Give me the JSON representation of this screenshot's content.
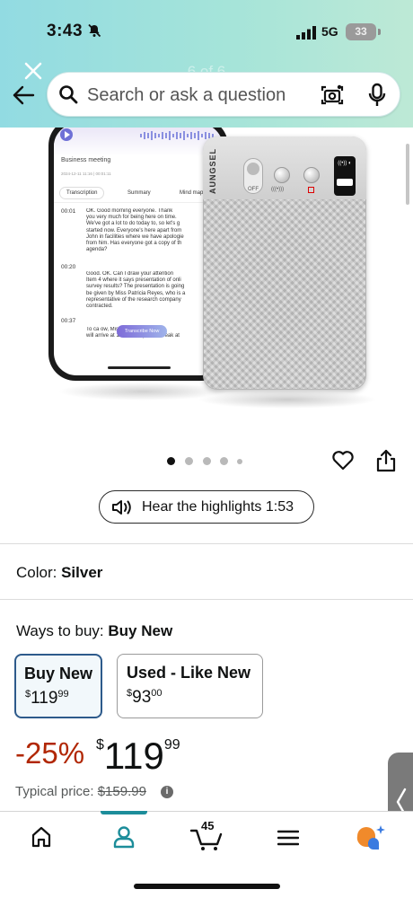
{
  "status_bar": {
    "time": "3:43",
    "network": "5G",
    "battery": "33"
  },
  "header": {
    "page_counter": "6 of 6",
    "search_placeholder": "Search or ask a question"
  },
  "product_image": {
    "brand": "AUNGSEL",
    "phone_screen": {
      "title": "Business meeting",
      "date": "2024-12-11 11:16  |  00:01:11",
      "tabs": [
        "Transcription",
        "Summary",
        "Mind mapp"
      ],
      "entries": [
        {
          "time": "00:01",
          "lines": [
            "OK. Good morning everyone. Thank",
            "you very much for being here on time.",
            "We've got a lot to do today to, so let's g",
            "started now. Everyone's here apart from",
            "John in facilities where we have apologie",
            "from him. Has everyone got a copy of th",
            "agenda?"
          ]
        },
        {
          "time": "00:20",
          "lines": [
            "Good. OK. Can I draw your attention",
            "Item 4 where it says presentation of onli",
            "survey results? The presentation is going",
            "be given by Miss Patricia Reyes, who is a",
            "representative of the research company",
            "contracted."
          ]
        },
        {
          "time": "00:37",
          "lines": [
            "To ca              ow, Miss Rey",
            "will arrive at 11:30, so I plan to break at"
          ]
        }
      ],
      "transcribe_button": "Transcribe Now"
    },
    "recorder_buttons": [
      "OFF",
      "(((•)))",
      ""
    ],
    "carousel": {
      "total": 5,
      "active": 0
    }
  },
  "highlights": {
    "label": "Hear the highlights 1:53"
  },
  "color": {
    "label": "Color:",
    "value": "Silver"
  },
  "ways_to_buy": {
    "label": "Ways to buy:",
    "value": "Buy New",
    "options": [
      {
        "title": "Buy New",
        "price_currency": "$",
        "price_whole": "119",
        "price_fraction": "99",
        "selected": true
      },
      {
        "title": "Used - Like New",
        "price_currency": "$",
        "price_whole": "93",
        "price_fraction": "00",
        "selected": false
      }
    ]
  },
  "price": {
    "discount": "-25%",
    "currency": "$",
    "whole": "119",
    "fraction": "99",
    "typical_label": "Typical price:",
    "typical_value": "$159.99"
  },
  "bottom_nav": {
    "items": [
      "home-icon",
      "account-icon",
      "cart-icon",
      "menu-icon",
      "rufus-icon"
    ],
    "cart_count": "45",
    "active": "account"
  },
  "colors": {
    "header_gradient_start": "#92dbe2",
    "header_gradient_end": "#bde9d6",
    "discount_red": "#b12704",
    "selected_border": "#2d5a8b",
    "nav_indicator": "#1c8d9a"
  }
}
